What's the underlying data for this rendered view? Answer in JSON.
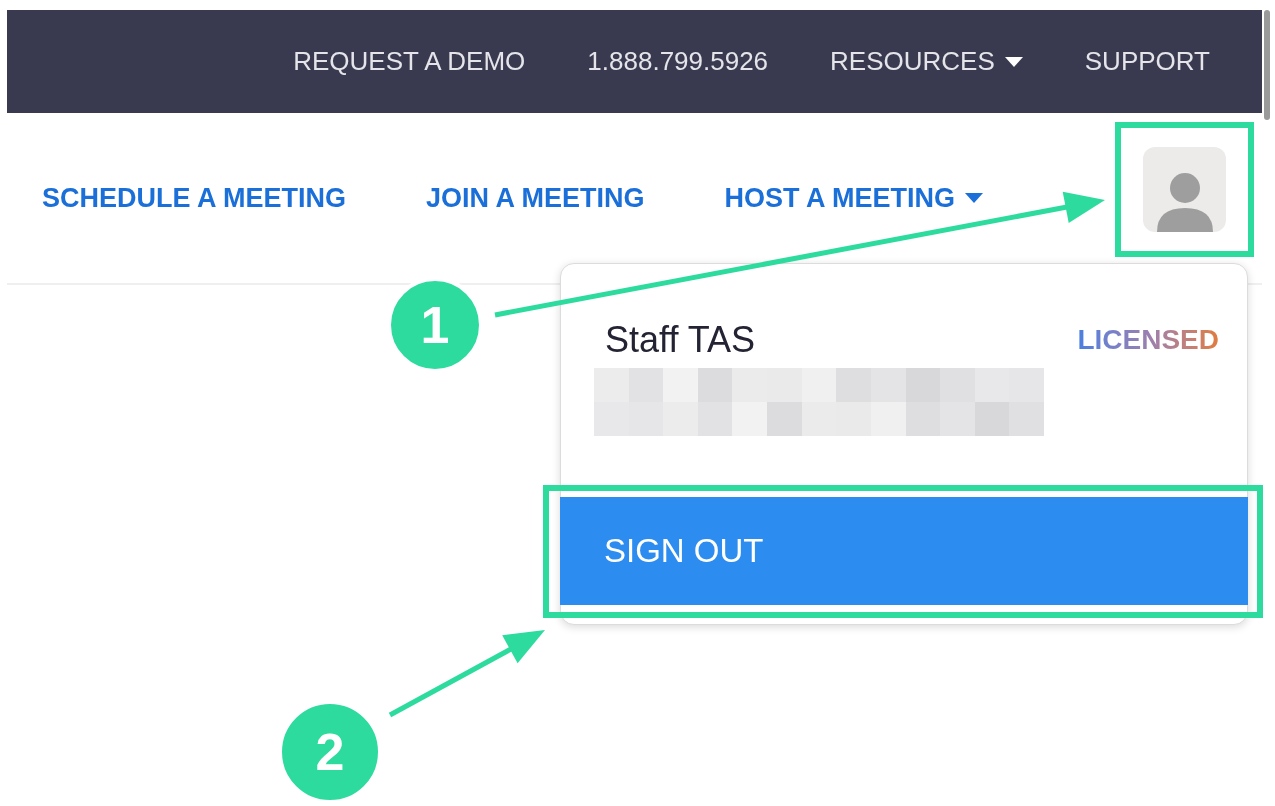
{
  "top_nav": {
    "items": [
      {
        "label": "REQUEST A DEMO",
        "kind": "link"
      },
      {
        "label": "1.888.799.5926",
        "kind": "link"
      },
      {
        "label": "RESOURCES",
        "kind": "dropdown"
      },
      {
        "label": "SUPPORT",
        "kind": "link"
      }
    ]
  },
  "main_nav": {
    "items": [
      {
        "label": "SCHEDULE A MEETING",
        "kind": "link"
      },
      {
        "label": "JOIN A MEETING",
        "kind": "link"
      },
      {
        "label": "HOST A MEETING",
        "kind": "dropdown"
      }
    ]
  },
  "account_menu": {
    "name": "Staff TAS",
    "badge": "LICENSED",
    "sign_out": "SIGN OUT"
  },
  "annotations": [
    {
      "number": "1"
    },
    {
      "number": "2"
    }
  ]
}
